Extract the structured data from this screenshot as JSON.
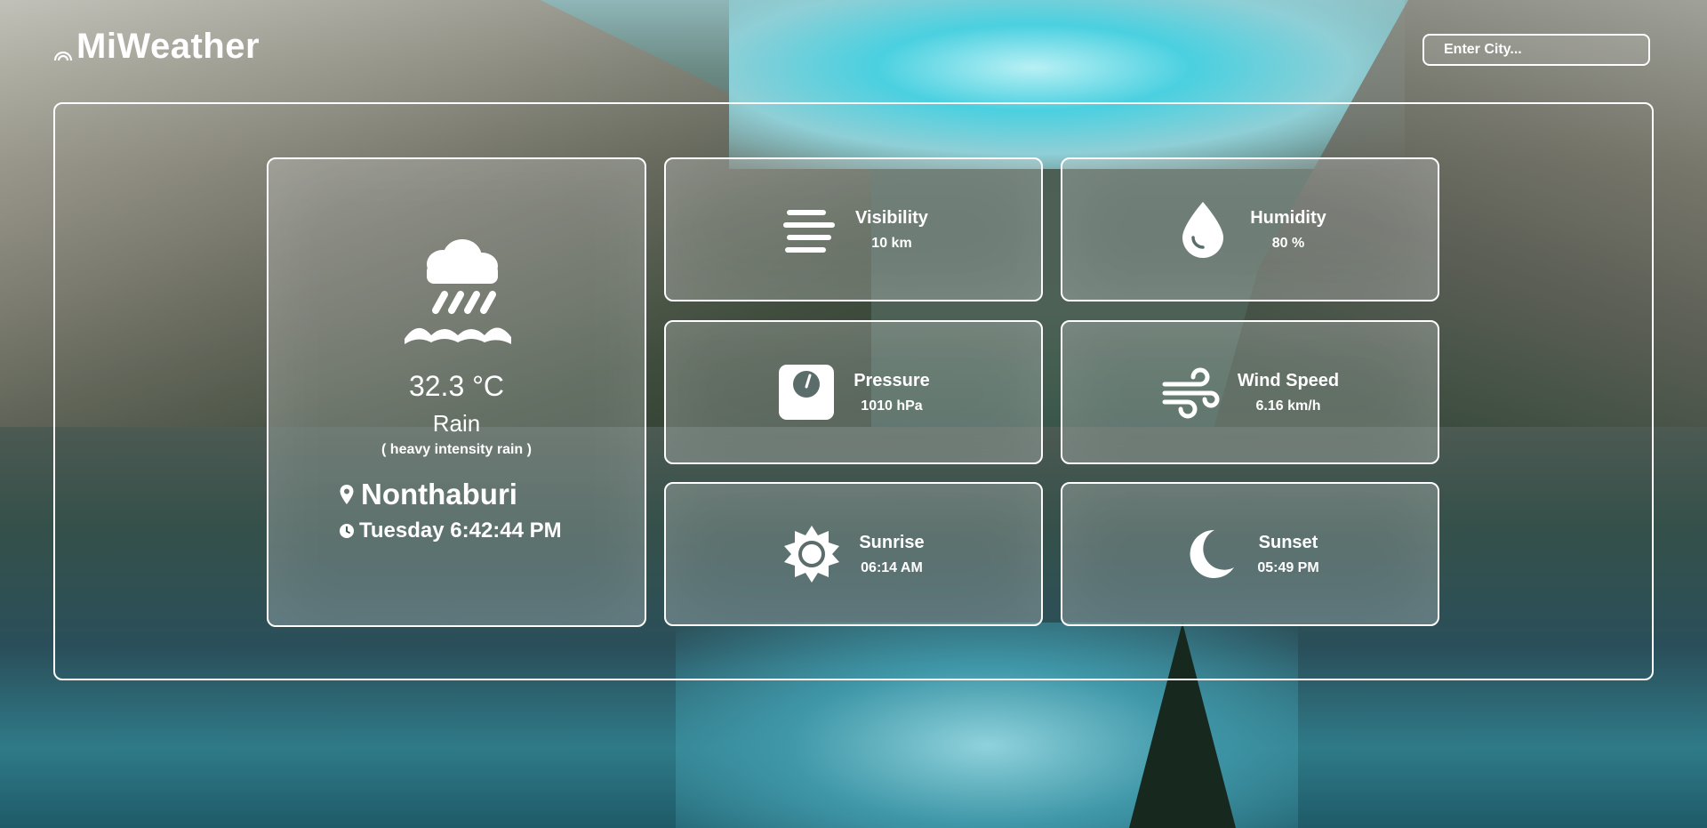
{
  "app": {
    "title": "MiWeather",
    "logo_icon": "rainbow-icon"
  },
  "search": {
    "placeholder": "Enter City...",
    "icon": "search-icon"
  },
  "current": {
    "icon": "rain-icon",
    "temperature": "32.3 °C",
    "condition": "Rain",
    "description": "( heavy intensity rain )",
    "location": "Nonthaburi",
    "datetime": "Tuesday 6:42:44 PM"
  },
  "stats": [
    {
      "key": "visibility",
      "label": "Visibility",
      "value": "10 km",
      "icon": "visibility-lines-icon"
    },
    {
      "key": "humidity",
      "label": "Humidity",
      "value": "80 %",
      "icon": "droplet-icon"
    },
    {
      "key": "pressure",
      "label": "Pressure",
      "value": "1010 hPa",
      "icon": "pressure-gauge-icon"
    },
    {
      "key": "wind",
      "label": "Wind Speed",
      "value": "6.16 km/h",
      "icon": "wind-icon"
    },
    {
      "key": "sunrise",
      "label": "Sunrise",
      "value": "06:14 AM",
      "icon": "sun-icon"
    },
    {
      "key": "sunset",
      "label": "Sunset",
      "value": "05:49 PM",
      "icon": "moon-icon"
    }
  ],
  "colors": {
    "text": "#ffffff",
    "border": "#ffffff",
    "card_bg": "rgba(200,205,205,0.28)"
  }
}
